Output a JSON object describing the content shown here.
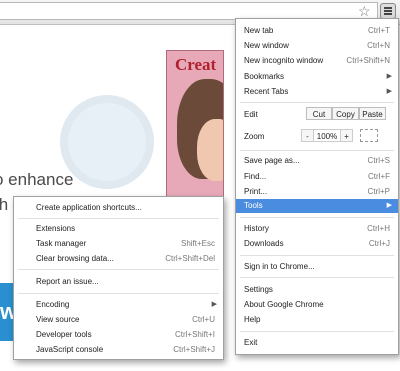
{
  "page": {
    "headline_part1": "o enhance",
    "headline_part2": "th",
    "promo_title": "Creat",
    "blue_letter": "w"
  },
  "icons": {
    "star": "star-icon",
    "menu": "chrome-menu-icon"
  },
  "main_menu": {
    "new_tab": {
      "label": "New tab",
      "shortcut": "Ctrl+T"
    },
    "new_window": {
      "label": "New window",
      "shortcut": "Ctrl+N"
    },
    "new_incognito": {
      "label": "New incognito window",
      "shortcut": "Ctrl+Shift+N"
    },
    "bookmarks": {
      "label": "Bookmarks"
    },
    "recent_tabs": {
      "label": "Recent Tabs"
    },
    "edit": {
      "label": "Edit",
      "cut": "Cut",
      "copy": "Copy",
      "paste": "Paste"
    },
    "zoom": {
      "label": "Zoom",
      "minus": "-",
      "value": "100%",
      "plus": "+"
    },
    "save_page": {
      "label": "Save page as...",
      "shortcut": "Ctrl+S"
    },
    "find": {
      "label": "Find...",
      "shortcut": "Ctrl+F"
    },
    "print": {
      "label": "Print...",
      "shortcut": "Ctrl+P"
    },
    "tools": {
      "label": "Tools"
    },
    "history": {
      "label": "History",
      "shortcut": "Ctrl+H"
    },
    "downloads": {
      "label": "Downloads",
      "shortcut": "Ctrl+J"
    },
    "sign_in": {
      "label": "Sign in to Chrome..."
    },
    "settings": {
      "label": "Settings"
    },
    "about": {
      "label": "About Google Chrome"
    },
    "help": {
      "label": "Help"
    },
    "exit": {
      "label": "Exit"
    }
  },
  "tools_menu": {
    "create_shortcuts": {
      "label": "Create application shortcuts..."
    },
    "extensions": {
      "label": "Extensions"
    },
    "task_manager": {
      "label": "Task manager",
      "shortcut": "Shift+Esc"
    },
    "clear_data": {
      "label": "Clear browsing data...",
      "shortcut": "Ctrl+Shift+Del"
    },
    "report_issue": {
      "label": "Report an issue..."
    },
    "encoding": {
      "label": "Encoding"
    },
    "view_source": {
      "label": "View source",
      "shortcut": "Ctrl+U"
    },
    "developer_tools": {
      "label": "Developer tools",
      "shortcut": "Ctrl+Shift+I"
    },
    "js_console": {
      "label": "JavaScript console",
      "shortcut": "Ctrl+Shift+J"
    }
  },
  "colors": {
    "highlight": "#4a8de0",
    "accent_blue": "#2a8fd0"
  }
}
